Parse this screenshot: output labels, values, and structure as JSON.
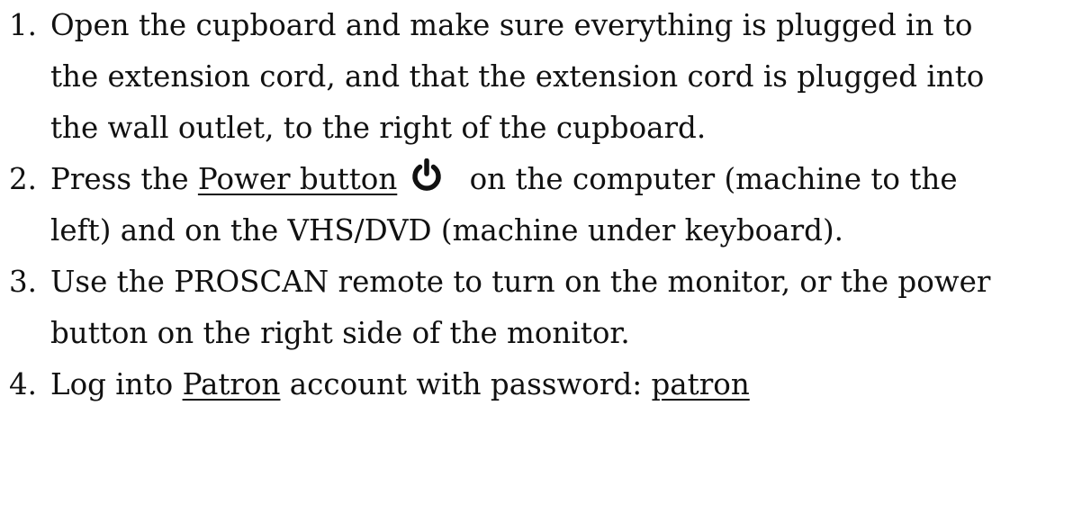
{
  "steps": [
    {
      "number": "1.",
      "lines": [
        "Open the cupboard and make sure everything is plugged in to",
        "the extension cord, and that the extension cord is plugged into",
        "the wall outlet, to the right of the cupboard."
      ]
    },
    {
      "number": "2.",
      "prefix": "Press the ",
      "link": "Power button",
      "suffix": " on the computer (machine to the",
      "line2": "left) and on the VHS/DVD (machine under keyboard).",
      "icon": "power-icon"
    },
    {
      "number": "3.",
      "lines": [
        "Use the PROSCAN remote to turn on the monitor, or the power",
        "button on the right side of the monitor."
      ]
    },
    {
      "number": "4.",
      "prefix": "Log into ",
      "account": "Patron",
      "middle": " account with password: ",
      "password": "patron"
    }
  ]
}
